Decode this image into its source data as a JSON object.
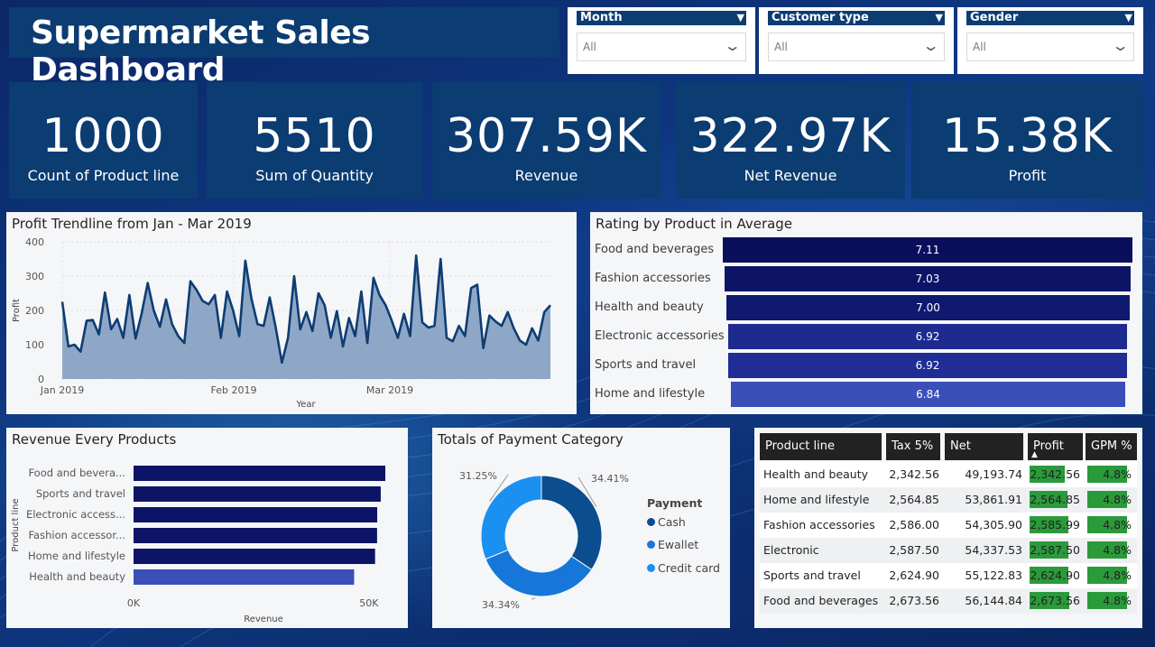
{
  "title": "Supermarket Sales Dashboard",
  "slicers": [
    {
      "label": "Month",
      "value": "All"
    },
    {
      "label": "Customer type",
      "value": "All"
    },
    {
      "label": "Gender",
      "value": "All"
    }
  ],
  "kpis": [
    {
      "value": "1000",
      "label": "Count of Product line"
    },
    {
      "value": "5510",
      "label": "Sum of Quantity"
    },
    {
      "value": "307.59K",
      "label": "Revenue"
    },
    {
      "value": "322.97K",
      "label": "Net Revenue"
    },
    {
      "value": "15.38K",
      "label": "Profit"
    }
  ],
  "colors": {
    "navy": "#0b3c72",
    "bar_dark": "#0a0f5c",
    "bar_mid": "#1d2a8f",
    "bar_light": "#3a4fb8",
    "line": "#0d3d73",
    "area": "#8fa7c7",
    "cash": "#0b4d8f",
    "ewallet": "#1677d9",
    "credit": "#1a90f0",
    "profit_green": "#2a9a3a"
  },
  "chart_data": [
    {
      "type": "area",
      "title": "Profit Trendline from Jan - Mar 2019",
      "xlabel": "Year",
      "ylabel": "Profit",
      "ylim": [
        0,
        400
      ],
      "yticks": [
        "0",
        "100",
        "200",
        "300",
        "400"
      ],
      "xticks": [
        "Jan 2019",
        "Feb 2019",
        "Mar 2019"
      ],
      "values": [
        225,
        95,
        100,
        80,
        170,
        172,
        130,
        252,
        145,
        175,
        120,
        245,
        118,
        190,
        280,
        200,
        152,
        232,
        160,
        125,
        105,
        285,
        260,
        228,
        218,
        245,
        120,
        255,
        200,
        125,
        345,
        235,
        160,
        155,
        238,
        148,
        48,
        120,
        300,
        145,
        195,
        140,
        250,
        215,
        120,
        198,
        95,
        178,
        125,
        255,
        105,
        295,
        245,
        215,
        170,
        120,
        190,
        125,
        360,
        165,
        150,
        155,
        350,
        120,
        110,
        155,
        125,
        265,
        275,
        90,
        185,
        168,
        155,
        195,
        148,
        112,
        100,
        148,
        112,
        195,
        215
      ]
    },
    {
      "type": "bar",
      "title": "Rating by Product in Average",
      "categories": [
        "Food and beverages",
        "Fashion accessories",
        "Health and beauty",
        "Electronic accessories",
        "Sports and travel",
        "Home and lifestyle"
      ],
      "values": [
        7.11,
        7.03,
        7.0,
        6.92,
        6.92,
        6.84
      ],
      "labels": [
        "7.11",
        "7.03",
        "7.00",
        "6.92",
        "6.92",
        "6.84"
      ]
    },
    {
      "type": "bar",
      "title": "Revenue Every Products",
      "xlabel": "Revenue",
      "ylabel": "Product line",
      "categories": [
        "Food and bevera...",
        "Sports and travel",
        "Electronic access...",
        "Fashion accessor...",
        "Home and lifestyle",
        "Health and beauty"
      ],
      "values": [
        53471.28,
        52497.93,
        51750.03,
        51719.9,
        51297.06,
        46851.18
      ],
      "xlim": [
        0,
        55000
      ],
      "xticks": [
        "0K",
        "50K"
      ]
    },
    {
      "type": "pie",
      "title": "Totals of Payment Category",
      "legend_title": "Payment",
      "categories": [
        "Cash",
        "Ewallet",
        "Credit card"
      ],
      "values": [
        34.41,
        34.34,
        31.25
      ],
      "labels": [
        "34.41%",
        "34.34%",
        "31.25%"
      ]
    },
    {
      "type": "table",
      "columns": [
        "Product line",
        "Tax 5%",
        "Net Revenue",
        "Profit",
        "GPM %"
      ],
      "rows": [
        [
          "Health and beauty",
          "2,342.56",
          "49,193.74",
          "2,342.56",
          "4.8%"
        ],
        [
          "Home and lifestyle",
          "2,564.85",
          "53,861.91",
          "2,564.85",
          "4.8%"
        ],
        [
          "Fashion accessories",
          "2,586.00",
          "54,305.90",
          "2,585.99",
          "4.8%"
        ],
        [
          "Electronic accessories",
          "2,587.50",
          "54,337.53",
          "2,587.50",
          "4.8%"
        ],
        [
          "Sports and travel",
          "2,624.90",
          "55,122.83",
          "2,624.90",
          "4.8%"
        ],
        [
          "Food and beverages",
          "2,673.56",
          "56,144.84",
          "2,673.56",
          "4.8%"
        ]
      ]
    }
  ]
}
